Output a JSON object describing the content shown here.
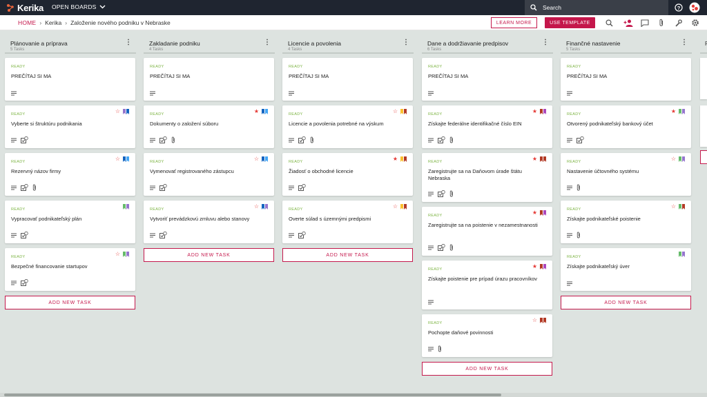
{
  "app": {
    "name": "Kerika",
    "open_boards": "OPEN BOARDS",
    "search_placeholder": "Search"
  },
  "crumb": {
    "home": "HOME",
    "org": "Kerika",
    "board": "Založenie nového podniku v Nebraske",
    "learn": "LEARN MORE",
    "use_template": "USE TEMPLATE"
  },
  "add_label": "ADD NEW TASK",
  "colors": {
    "accent": "#c4174b",
    "ready": "#7cb342",
    "red": "#e53935",
    "blue": "#1565c0",
    "lightblue": "#42a5f5",
    "purple": "#9575cd",
    "green": "#66bb6a",
    "yellow": "#fbc02d",
    "darkred": "#b23a25",
    "magenta": "#ab47bc"
  },
  "columns": [
    {
      "title": "Plánovanie a príprava",
      "count": "5 Tasks",
      "cards": [
        {
          "status": "READY",
          "title": "PREČÍTAJ SI MA",
          "flags": [],
          "star": "",
          "icons": [
            "desc"
          ]
        },
        {
          "status": "READY",
          "title": "Vyberte si štruktúru podnikania",
          "flags": [
            "purple",
            "blue"
          ],
          "star": "outline",
          "icons": [
            "desc",
            "check"
          ]
        },
        {
          "status": "READY",
          "title": "Rezervný názov firmy",
          "flags": [
            "blue",
            "lightblue"
          ],
          "star": "outline",
          "icons": [
            "desc",
            "check",
            "attach"
          ]
        },
        {
          "status": "READY",
          "title": "Vypracovať podnikateľský plán",
          "flags": [
            "green",
            "purple"
          ],
          "star": "",
          "icons": [
            "desc",
            "check"
          ]
        },
        {
          "status": "READY",
          "title": "Bezpečné financovanie startupov",
          "flags": [
            "green",
            "purple"
          ],
          "star": "outline",
          "icons": [
            "desc",
            "check"
          ]
        }
      ]
    },
    {
      "title": "Zakladanie podniku",
      "count": "4 Tasks",
      "cards": [
        {
          "status": "READY",
          "title": "PREČÍTAJ SI MA",
          "flags": [],
          "star": "",
          "icons": [
            "desc"
          ]
        },
        {
          "status": "READY",
          "title": "Dokumenty o založení súboru",
          "flags": [
            "blue",
            "lightblue"
          ],
          "star": "filled",
          "icons": [
            "desc",
            "check",
            "attach"
          ]
        },
        {
          "status": "READY",
          "title": "Vymenovať registrovaného zástupcu",
          "flags": [
            "blue",
            "lightblue"
          ],
          "star": "outline",
          "icons": [
            "desc",
            "check"
          ]
        },
        {
          "status": "READY",
          "title": "Vytvoriť prevádzkovú zmluvu alebo stanovy",
          "flags": [
            "blue",
            "purple"
          ],
          "star": "outline",
          "icons": [
            "desc",
            "check"
          ]
        }
      ]
    },
    {
      "title": "Licencie a povolenia",
      "count": "4 Tasks",
      "cards": [
        {
          "status": "READY",
          "title": "PREČÍTAJ SI MA",
          "flags": [],
          "star": "",
          "icons": [
            "desc"
          ]
        },
        {
          "status": "READY",
          "title": "Licencie a povolenia potrebné na výskum",
          "flags": [
            "yellow",
            "darkred"
          ],
          "star": "outline",
          "icons": [
            "desc",
            "check",
            "attach"
          ]
        },
        {
          "status": "READY",
          "title": "Žiadosť o obchodné licencie",
          "flags": [
            "yellow",
            "darkred"
          ],
          "star": "filled",
          "icons": [
            "desc",
            "check"
          ]
        },
        {
          "status": "READY",
          "title": "Overte súlad s územnými predpismi",
          "flags": [
            "yellow",
            "darkred"
          ],
          "star": "outline",
          "icons": [
            "desc",
            "check"
          ]
        }
      ]
    },
    {
      "title": "Dane a dodržiavanie predpisov",
      "count": "6 Tasks",
      "cards": [
        {
          "status": "READY",
          "title": "PREČÍTAJ SI MA",
          "flags": [],
          "star": "",
          "icons": [
            "desc"
          ]
        },
        {
          "status": "READY",
          "title": "Získajte federálne identifikačné číslo EIN",
          "flags": [
            "darkred",
            "magenta"
          ],
          "star": "filled",
          "icons": [
            "desc",
            "check",
            "attach"
          ]
        },
        {
          "status": "READY",
          "title": "Zaregistrujte sa na Daňovom úrade štátu Nebraska",
          "flags": [
            "darkred",
            "darkred"
          ],
          "star": "filled",
          "icons": [
            "desc",
            "check",
            "attach"
          ]
        },
        {
          "status": "READY",
          "title": "Zaregistrujte sa na poistenie v nezamestnanosti",
          "flags": [
            "darkred",
            "magenta"
          ],
          "star": "filled",
          "icons": [
            "desc",
            "check",
            "attach"
          ]
        },
        {
          "status": "READY",
          "title": "Získajte poistenie pre prípad úrazu pracovníkov",
          "flags": [
            "darkred",
            "magenta"
          ],
          "star": "filled",
          "icons": [
            "desc"
          ]
        },
        {
          "status": "READY",
          "title": "Pochopte daňové povinnosti",
          "flags": [
            "darkred",
            "darkred"
          ],
          "star": "outline",
          "icons": [
            "desc",
            "attach"
          ]
        }
      ]
    },
    {
      "title": "Finančné nastavenie",
      "count": "5 Tasks",
      "cards": [
        {
          "status": "READY",
          "title": "PREČÍTAJ SI MA",
          "flags": [],
          "star": "",
          "icons": [
            "desc"
          ]
        },
        {
          "status": "READY",
          "title": "Otvorený podnikateľský bankový účet",
          "flags": [
            "green",
            "purple"
          ],
          "star": "filled",
          "icons": [
            "desc",
            "check"
          ]
        },
        {
          "status": "READY",
          "title": "Nastavenie účtovného systému",
          "flags": [
            "green",
            "purple"
          ],
          "star": "outline",
          "icons": [
            "desc",
            "attach"
          ]
        },
        {
          "status": "READY",
          "title": "Získajte podnikateľské poistenie",
          "flags": [
            "green",
            "darkred"
          ],
          "star": "outline",
          "icons": [
            "desc",
            "attach"
          ]
        },
        {
          "status": "READY",
          "title": "Získajte podnikateľský úver",
          "flags": [
            "green",
            "purple"
          ],
          "star": "",
          "icons": [
            "desc"
          ]
        }
      ]
    }
  ]
}
